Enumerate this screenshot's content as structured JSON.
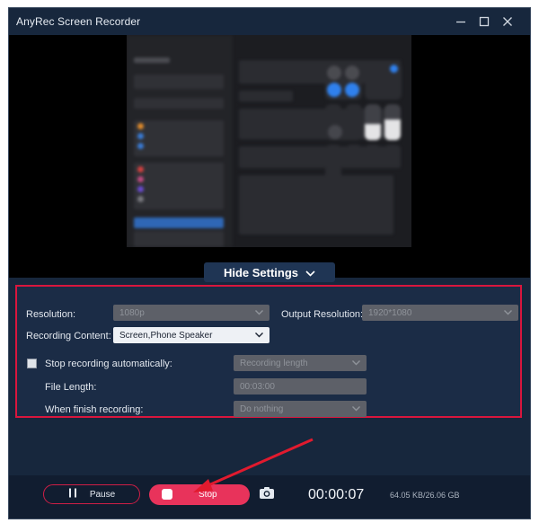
{
  "window": {
    "title": "AnyRec Screen Recorder",
    "minimize_icon": "minimize-icon",
    "maximize_icon": "maximize-icon",
    "close_icon": "close-icon"
  },
  "preview": {
    "hide_settings_label": "Hide Settings",
    "hide_settings_icon": "chevron-down-icon"
  },
  "settings": {
    "resolution": {
      "label": "Resolution:",
      "value": "1080p",
      "disabled": true
    },
    "output_resolution": {
      "label": "Output Resolution:",
      "value": "1920*1080",
      "disabled": true
    },
    "recording_content": {
      "label": "Recording Content:",
      "value": "Screen,Phone Speaker"
    },
    "stop_auto": {
      "label": "Stop recording automatically:",
      "checked": false,
      "value": "Recording length",
      "disabled": true
    },
    "file_length": {
      "label": "File Length:",
      "value": "00:03:00",
      "disabled": true
    },
    "when_finish": {
      "label": "When finish recording:",
      "value": "Do nothing",
      "disabled": true
    }
  },
  "controls": {
    "pause_label": "Pause",
    "stop_label": "Stop",
    "snapshot_icon": "camera-icon",
    "timer": "00:00:07",
    "file_size": "64.05 KB/26.06 GB"
  },
  "colors": {
    "accent": "#e8335b",
    "highlight_border": "#d9163d",
    "window_bg": "#17273d",
    "panel_bg": "#1b2c46"
  }
}
